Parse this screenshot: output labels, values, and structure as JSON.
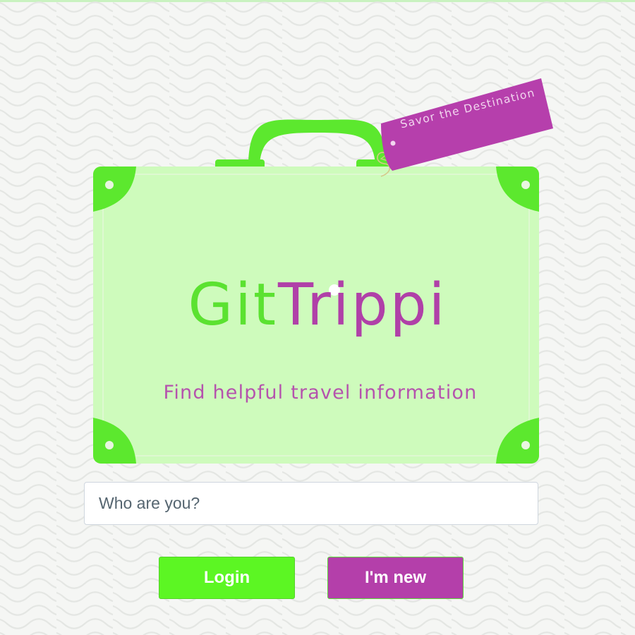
{
  "brand": {
    "name_part_1": "Git",
    "name_part_2": "Trippi",
    "tagline": "Find helpful travel information"
  },
  "luggage_tag": {
    "text": "Savor the Destination"
  },
  "login_form": {
    "name_placeholder": "Who are you?",
    "name_value": "",
    "login_label": "Login",
    "new_user_label": "I'm new"
  },
  "colors": {
    "brand_green": "#5cf623",
    "brand_purple": "#b43faa",
    "suitcase_body": "#cefbbc",
    "background": "#f5f6f4"
  },
  "icons": {
    "hero": "suitcase-illustration",
    "tag": "luggage-tag"
  }
}
